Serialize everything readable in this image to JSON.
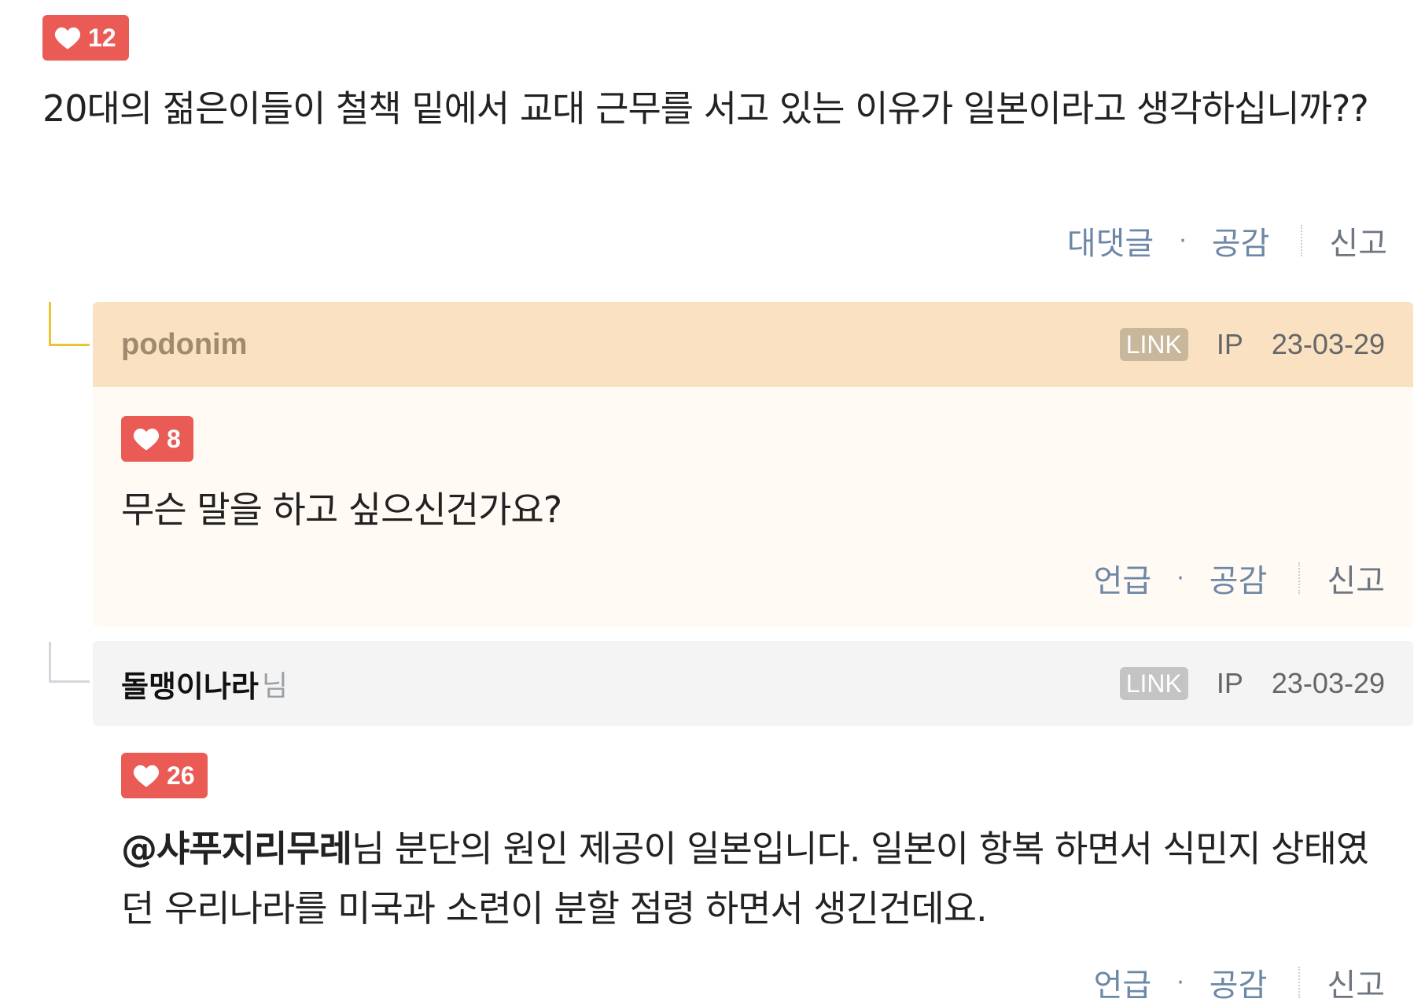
{
  "top_comment": {
    "likes": "12",
    "text": "20대의 젊은이들이 철책 밑에서 교대 근무를 서고 있는 이유가 일본이라고 생각하십니까??",
    "actions": {
      "reply": "대댓글",
      "separator": "·",
      "like": "공감",
      "report": "신고"
    }
  },
  "replies": [
    {
      "author": "podonim",
      "author_suffix": "",
      "link_badge": "LINK",
      "ip": "IP",
      "date": "23-03-29",
      "likes": "8",
      "text": "무슨 말을 하고 싶으신건가요?",
      "actions": {
        "mention": "언급",
        "separator": "·",
        "like": "공감",
        "report": "신고"
      },
      "header_bg": "#f9e1c2",
      "body_bg": "#fffaf3"
    },
    {
      "author": "돌맹이나라",
      "author_suffix": "님",
      "link_badge": "LINK",
      "ip": "IP",
      "date": "23-03-29",
      "likes": "26",
      "mention_name": "@샤푸지리무레",
      "text": "님 분단의 원인 제공이 일본입니다. 일본이 항복 하면서 식민지 상태였던 우리나라를 미국과 소련이 분할 점령 하면서 생긴건데요.",
      "actions": {
        "mention": "언급",
        "separator": "·",
        "like": "공감",
        "report": "신고"
      },
      "header_bg": "#f4f4f5"
    }
  ],
  "colors": {
    "like_badge": "#ea5b56",
    "action_link": "#6d87a6",
    "author_highlight": "#a08a6e",
    "reply_line_highlight": "#e8c534",
    "reply_line_normal": "#d3d6da"
  }
}
